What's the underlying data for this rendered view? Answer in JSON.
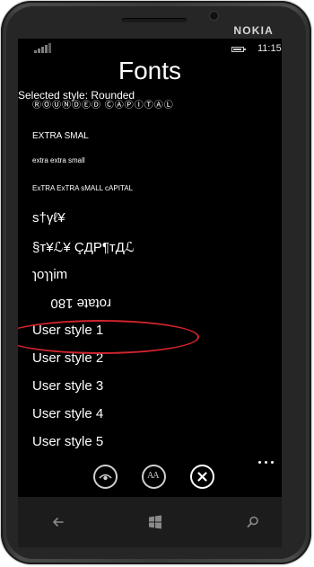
{
  "device": {
    "brand": "NOKIA"
  },
  "status_bar": {
    "time": "11:15",
    "signal_icon": "signal-bars-icon",
    "battery_icon": "battery-icon"
  },
  "page": {
    "title": "Fonts",
    "selected_label": "Selected style: Rounded"
  },
  "font_list": [
    {
      "label": "ⓇⓄⓊⓃⒹⒺⒹ ⒸⒶⓅⒾⓉⒶⓁ"
    },
    {
      "label": "EXTRA SMAL"
    },
    {
      "label": "extra extra small"
    },
    {
      "label": "ExTRA ExTRA sMALL cAPITAL"
    },
    {
      "label": "ѕ†γℓ¥"
    },
    {
      "label": "§т¥ℒ¥ ÇДР¶тДℒ"
    },
    {
      "label": "ɿoɿɿim"
    },
    {
      "label": "rotate 180"
    },
    {
      "label": "User style 1"
    },
    {
      "label": "User style 2"
    },
    {
      "label": "User style 3"
    },
    {
      "label": "User style 4"
    },
    {
      "label": "User style 5"
    }
  ],
  "app_bar": {
    "buttons": [
      {
        "icon": "eye-icon"
      },
      {
        "icon": "font-size-icon",
        "text": "AA"
      },
      {
        "icon": "close-icon"
      }
    ],
    "more_icon": "more-dots-icon"
  },
  "navbar": {
    "back_icon": "back-arrow-icon",
    "start_icon": "windows-logo-icon",
    "search_icon": "search-icon"
  },
  "colors": {
    "highlight": "#d2242d",
    "background": "#000000",
    "text": "#ffffff"
  }
}
